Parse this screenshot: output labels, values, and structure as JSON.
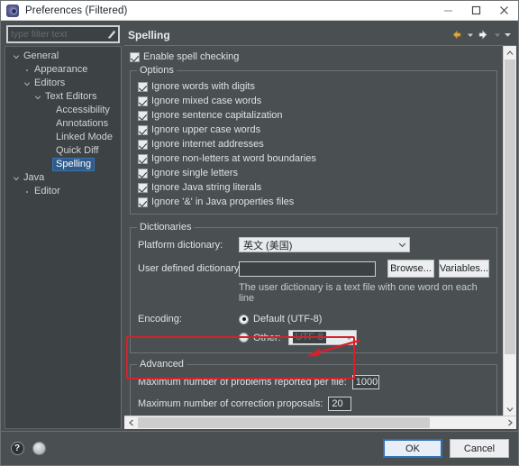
{
  "window": {
    "title": "Preferences (Filtered)",
    "icon": "preferences-icon",
    "minimize_label": "–",
    "maximize_label": "☐",
    "close_label": "✕"
  },
  "sidebar": {
    "filter": {
      "value": "",
      "placeholder": "type filter text",
      "clear_icon": "clear-filter-icon"
    },
    "tree": [
      {
        "label": "General",
        "depth": 0,
        "twisty": "expanded",
        "selected": false
      },
      {
        "label": "Appearance",
        "depth": 1,
        "twisty": "leaf",
        "selected": false
      },
      {
        "label": "Editors",
        "depth": 1,
        "twisty": "expanded",
        "selected": false
      },
      {
        "label": "Text Editors",
        "depth": 2,
        "twisty": "expanded",
        "selected": false
      },
      {
        "label": "Accessibility",
        "depth": 3,
        "twisty": "none",
        "selected": false
      },
      {
        "label": "Annotations",
        "depth": 3,
        "twisty": "none",
        "selected": false
      },
      {
        "label": "Linked Mode",
        "depth": 3,
        "twisty": "none",
        "selected": false
      },
      {
        "label": "Quick Diff",
        "depth": 3,
        "twisty": "none",
        "selected": false
      },
      {
        "label": "Spelling",
        "depth": 3,
        "twisty": "none",
        "selected": true
      },
      {
        "label": "Java",
        "depth": 0,
        "twisty": "expanded",
        "selected": false
      },
      {
        "label": "Editor",
        "depth": 1,
        "twisty": "leaf",
        "selected": false
      }
    ]
  },
  "page": {
    "title": "Spelling",
    "nav": {
      "back_icon": "arrow-left-icon",
      "back_menu_icon": "chevron-down-icon",
      "forward_icon": "arrow-right-icon",
      "forward_menu_icon": "chevron-down-icon",
      "view_menu_icon": "chevron-down-icon"
    },
    "enable": {
      "label": "Enable spell checking",
      "checked": true
    },
    "options": {
      "legend": "Options",
      "items": [
        {
          "label": "Ignore words with digits",
          "checked": true
        },
        {
          "label": "Ignore mixed case words",
          "checked": true
        },
        {
          "label": "Ignore sentence capitalization",
          "checked": true
        },
        {
          "label": "Ignore upper case words",
          "checked": true
        },
        {
          "label": "Ignore internet addresses",
          "checked": true
        },
        {
          "label": "Ignore non-letters at word boundaries",
          "checked": true
        },
        {
          "label": "Ignore single letters",
          "checked": true
        },
        {
          "label": "Ignore Java string literals",
          "checked": true
        },
        {
          "label": "Ignore '&' in Java properties files",
          "checked": true
        }
      ]
    },
    "dictionaries": {
      "legend": "Dictionaries",
      "platform_label": "Platform dictionary:",
      "platform_value": "英文 (美国)",
      "user_label": "User defined dictionary:",
      "user_value": "",
      "browse_label": "Browse...",
      "variables_label": "Variables...",
      "hint": "The user dictionary is a text file with one word on each line",
      "encoding_label": "Encoding:",
      "encoding_default_label": "Default (UTF-8)",
      "encoding_default_selected": true,
      "encoding_other_label": "Other:",
      "encoding_other_selected": false,
      "encoding_other_value": "UTF-8"
    },
    "advanced": {
      "legend": "Advanced",
      "max_problems_label": "Maximum number of problems reported per file:",
      "max_problems_value": "1000",
      "max_proposals_label": "Maximum number of correction proposals:",
      "max_proposals_value": "20"
    },
    "scroll": {
      "up_icon": "chevron-up-icon",
      "down_icon": "chevron-down-icon",
      "left_icon": "chevron-left-icon",
      "right_icon": "chevron-right-icon"
    }
  },
  "annotation": {
    "color": "#d8202a",
    "shape": "rounded-rect-with-arrow"
  },
  "footer": {
    "help_icon": "help-icon",
    "help_label": "?",
    "apply_icon": "apply-icon",
    "ok_label": "OK",
    "cancel_label": "Cancel"
  }
}
